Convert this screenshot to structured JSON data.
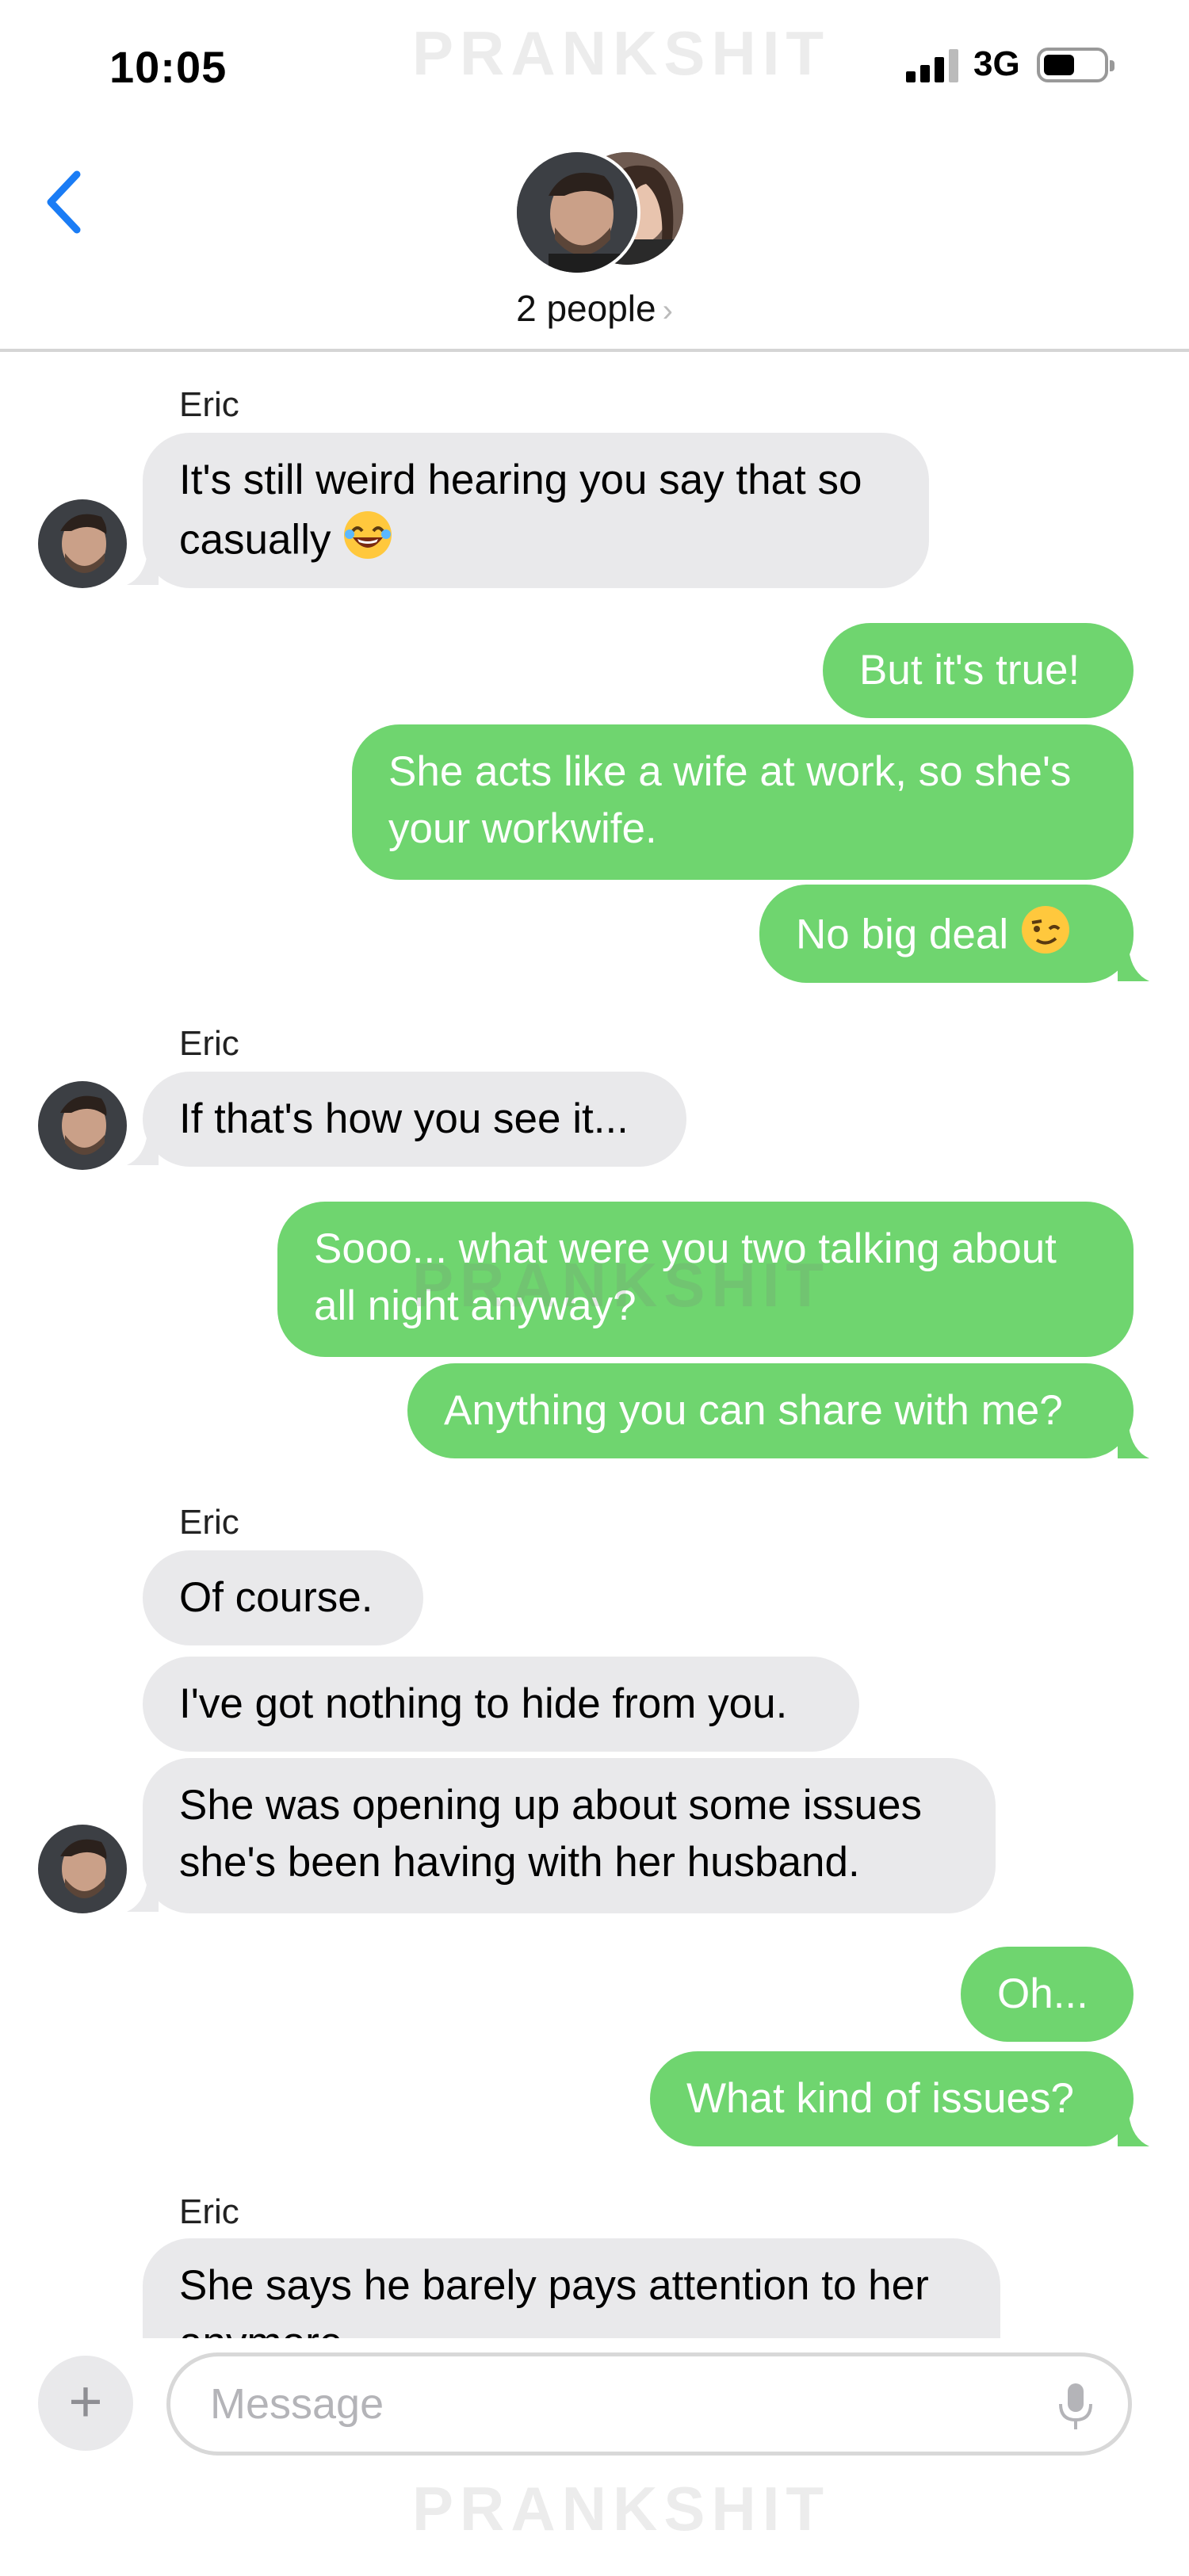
{
  "status": {
    "time": "10:05",
    "network": "3G",
    "watermark": "PRANKSHIT"
  },
  "header": {
    "back_icon": "chevron-left-icon",
    "participants": "2 people",
    "chevron": "›"
  },
  "colors": {
    "incoming": "#e9e9eb",
    "outgoing": "#6fd56f",
    "accent": "#1a7cf5"
  },
  "messages": [
    {
      "sender": "Eric",
      "text_lines": [
        "It's still weird hearing you say that so",
        "casually"
      ],
      "emoji": "rolling-laughing"
    },
    {
      "text": "But it's true!"
    },
    {
      "text_lines": [
        "She acts like a wife at work, so she's",
        "your workwife."
      ]
    },
    {
      "text": "No big deal",
      "emoji": "winking-face"
    },
    {
      "sender": "Eric",
      "text": "If that's how you see it..."
    },
    {
      "text_lines": [
        "Sooo... what were you two talking about",
        "all night anyway?"
      ]
    },
    {
      "text": "Anything you can share with me?"
    },
    {
      "sender": "Eric",
      "text": "Of course."
    },
    {
      "text": "I've got nothing to hide from you."
    },
    {
      "text_lines": [
        "She was opening up about some issues",
        "she's been having with her husband."
      ]
    },
    {
      "text": "Oh..."
    },
    {
      "text": "What kind of issues?"
    },
    {
      "sender": "Eric",
      "text_lines": [
        "She says he barely pays attention to her",
        "anymore"
      ]
    }
  ],
  "composer": {
    "plus": "+",
    "placeholder": "Message"
  }
}
